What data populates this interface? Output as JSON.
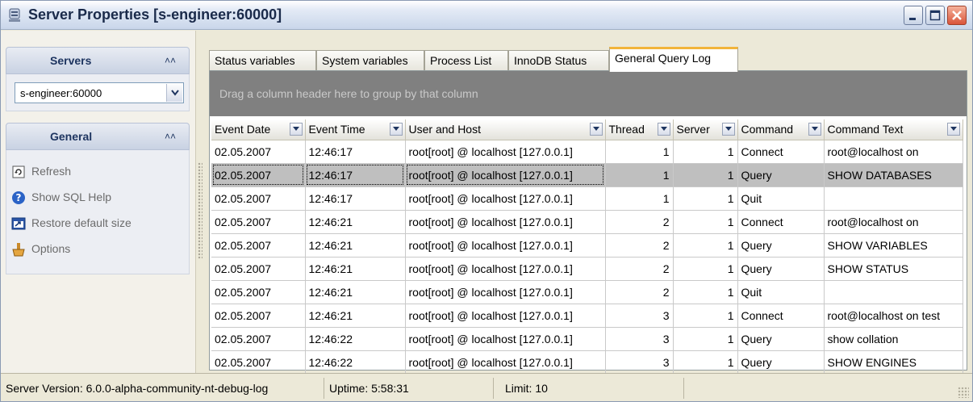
{
  "window": {
    "title": "Server Properties [s-engineer:60000]"
  },
  "sidebar": {
    "servers_group": {
      "label": "Servers",
      "selected_server": "s-engineer:60000"
    },
    "general_group": {
      "label": "General",
      "items": [
        {
          "label": "Refresh",
          "icon": "refresh-icon"
        },
        {
          "label": "Show SQL Help",
          "icon": "help-icon"
        },
        {
          "label": "Restore default size",
          "icon": "restore-size-icon"
        },
        {
          "label": "Options",
          "icon": "options-icon"
        }
      ]
    }
  },
  "tabs": [
    {
      "label": "Status variables",
      "active": false
    },
    {
      "label": "System variables",
      "active": false
    },
    {
      "label": "Process List",
      "active": false
    },
    {
      "label": "InnoDB Status",
      "active": false
    },
    {
      "label": "General Query Log",
      "active": true
    }
  ],
  "grid": {
    "group_hint": "Drag a column header here to group by that column",
    "columns": [
      "Event Date",
      "Event Time",
      "User and Host",
      "Thread",
      "Server",
      "Command",
      "Command Text"
    ],
    "rows": [
      [
        "02.05.2007",
        "12:46:17",
        "root[root] @ localhost [127.0.0.1]",
        "1",
        "1",
        "Connect",
        "root@localhost on"
      ],
      [
        "02.05.2007",
        "12:46:17",
        "root[root] @ localhost [127.0.0.1]",
        "1",
        "1",
        "Query",
        "SHOW DATABASES"
      ],
      [
        "02.05.2007",
        "12:46:17",
        "root[root] @ localhost [127.0.0.1]",
        "1",
        "1",
        "Quit",
        ""
      ],
      [
        "02.05.2007",
        "12:46:21",
        "root[root] @ localhost [127.0.0.1]",
        "2",
        "1",
        "Connect",
        "root@localhost on"
      ],
      [
        "02.05.2007",
        "12:46:21",
        "root[root] @ localhost [127.0.0.1]",
        "2",
        "1",
        "Query",
        "SHOW VARIABLES"
      ],
      [
        "02.05.2007",
        "12:46:21",
        "root[root] @ localhost [127.0.0.1]",
        "2",
        "1",
        "Query",
        "SHOW STATUS"
      ],
      [
        "02.05.2007",
        "12:46:21",
        "root[root] @ localhost [127.0.0.1]",
        "2",
        "1",
        "Quit",
        ""
      ],
      [
        "02.05.2007",
        "12:46:21",
        "root[root] @ localhost [127.0.0.1]",
        "3",
        "1",
        "Connect",
        "root@localhost on test"
      ],
      [
        "02.05.2007",
        "12:46:22",
        "root[root] @ localhost [127.0.0.1]",
        "3",
        "1",
        "Query",
        "show collation"
      ],
      [
        "02.05.2007",
        "12:46:22",
        "root[root] @ localhost [127.0.0.1]",
        "3",
        "1",
        "Query",
        "SHOW ENGINES"
      ]
    ],
    "selected_row": 1
  },
  "statusbar": {
    "server_version": "Server Version: 6.0.0-alpha-community-nt-debug-log",
    "uptime": "Uptime: 5:58:31",
    "limit": "Limit: 10"
  }
}
